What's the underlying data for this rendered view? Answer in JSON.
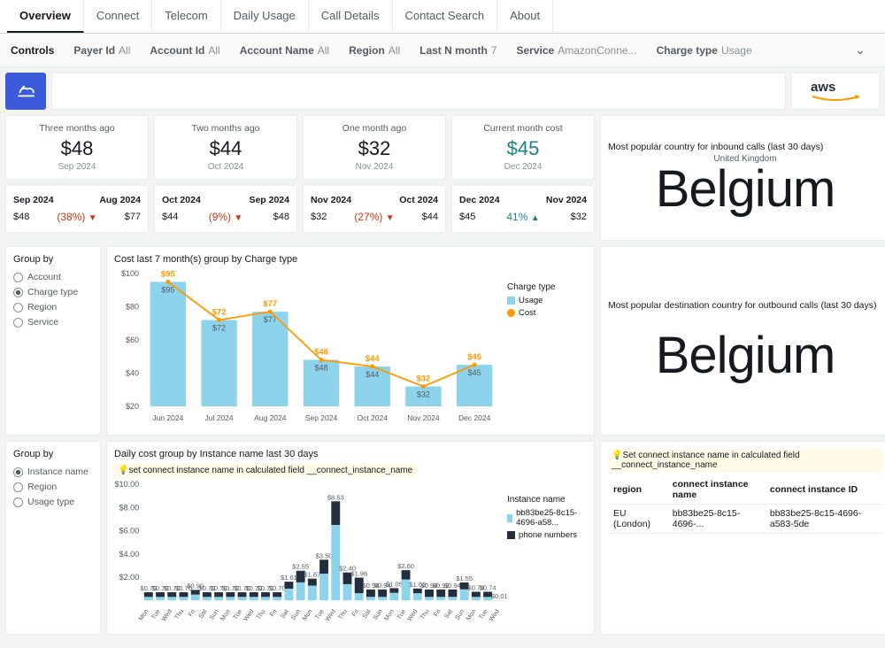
{
  "tabs": [
    "Overview",
    "Connect",
    "Telecom",
    "Daily Usage",
    "Call Details",
    "Contact Search",
    "About"
  ],
  "active_tab": 0,
  "controls": {
    "label": "Controls",
    "items": [
      {
        "label": "Payer Id",
        "value": "All"
      },
      {
        "label": "Account Id",
        "value": "All"
      },
      {
        "label": "Account Name",
        "value": "All"
      },
      {
        "label": "Region",
        "value": "All"
      },
      {
        "label": "Last N month",
        "value": "7"
      },
      {
        "label": "Service",
        "value": "AmazonConne..."
      },
      {
        "label": "Charge type",
        "value": "Usage"
      }
    ]
  },
  "kpis": [
    {
      "title": "Three months ago",
      "value": "$48",
      "sub": "Sep 2024"
    },
    {
      "title": "Two months ago",
      "value": "$44",
      "sub": "Oct 2024"
    },
    {
      "title": "One month ago",
      "value": "$32",
      "sub": "Nov 2024"
    },
    {
      "title": "Current month cost",
      "value": "$45",
      "sub": "Dec 2024",
      "teal": true
    }
  ],
  "comps": [
    {
      "left_m": "Sep 2024",
      "right_m": "Aug 2024",
      "left_v": "$48",
      "right_v": "$77",
      "pct": "(38%)",
      "dir": "down"
    },
    {
      "left_m": "Oct 2024",
      "right_m": "Sep 2024",
      "left_v": "$44",
      "right_v": "$48",
      "pct": "(9%)",
      "dir": "down"
    },
    {
      "left_m": "Nov 2024",
      "right_m": "Oct 2024",
      "left_v": "$32",
      "right_v": "$44",
      "pct": "(27%)",
      "dir": "down"
    },
    {
      "left_m": "Dec 2024",
      "right_m": "Nov 2024",
      "left_v": "$45",
      "right_v": "$32",
      "pct": "41%",
      "dir": "up"
    }
  ],
  "inbound": {
    "label": "Most popular country for inbound calls (last 30 days)",
    "sub": "United Kingdom",
    "value": "Belgium"
  },
  "outbound": {
    "label": "Most popular destination country for outbound calls (last 30 days)",
    "value": "Belgium"
  },
  "groupby1": {
    "title": "Group by",
    "options": [
      "Account",
      "Charge type",
      "Region",
      "Service"
    ],
    "selected": 1
  },
  "groupby2": {
    "title": "Group by",
    "options": [
      "Instance name",
      "Region",
      "Usage type"
    ],
    "selected": 0
  },
  "chart1": {
    "title": "Cost last  7 month(s) group by  Charge type",
    "legend_title": "Charge type",
    "legend": [
      "Usage",
      "Cost"
    ]
  },
  "chart2": {
    "title": "Daily cost group by Instance name last 30 days",
    "hint": "💡set connect instance name in calculated field __connect_instance_name",
    "legend_title": "Instance name",
    "legend": [
      "bb83be25-8c15-4696-a58...",
      "phone numbers"
    ]
  },
  "bottom_right": {
    "hint": "💡Set connect instance name in calculated field __connect_instance_name",
    "headers": [
      "region",
      "connect instance name",
      "connect instance ID"
    ],
    "rows": [
      [
        "EU (London)",
        "bb83be25-8c15-4696-...",
        "bb83be25-8c15-4696-a583-5de"
      ]
    ]
  },
  "chart_data": [
    {
      "type": "bar",
      "title": "Cost last 7 month(s) group by Charge type",
      "categories": [
        "Jun 2024",
        "Jul 2024",
        "Aug 2024",
        "Sep 2024",
        "Oct 2024",
        "Nov 2024",
        "Dec 2024"
      ],
      "series": [
        {
          "name": "Usage",
          "values": [
            95,
            72,
            77,
            48,
            44,
            32,
            45
          ],
          "type": "bar"
        },
        {
          "name": "Cost",
          "values": [
            95,
            72,
            77,
            48,
            44,
            32,
            45
          ],
          "type": "line"
        }
      ],
      "yticks": [
        20,
        40,
        60,
        80,
        100
      ],
      "ylim": [
        20,
        100
      ],
      "ylabel": "",
      "xlabel": ""
    },
    {
      "type": "bar",
      "title": "Daily cost group by Instance name last 30 days",
      "categories": [
        "Mon",
        "Tue",
        "Wed",
        "Thu",
        "Fri",
        "Sat",
        "Sun",
        "Mon",
        "Tue",
        "Wed",
        "Thu",
        "Fri",
        "Sat",
        "Sun",
        "Mon",
        "Tue",
        "Wed",
        "Thu",
        "Fri",
        "Sat",
        "Sun",
        "Mon",
        "Tue",
        "Wed",
        "Thu",
        "Fri",
        "Sat",
        "Sun",
        "Mon",
        "Tue",
        "Wed"
      ],
      "series": [
        {
          "name": "bb83be25-8c15-4696-a58...",
          "values": [
            0.3,
            0.3,
            0.3,
            0.3,
            0.5,
            0.3,
            0.3,
            0.3,
            0.3,
            0.3,
            0.3,
            0.3,
            1.01,
            1.55,
            1.27,
            2.3,
            6.5,
            1.4,
            0.62,
            0.3,
            0.3,
            0.65,
            1.8,
            0.62,
            0.3,
            0.3,
            0.3,
            0.95,
            0.3,
            0.3,
            0.01
          ]
        },
        {
          "name": "phone numbers",
          "values": [
            0.4,
            0.4,
            0.4,
            0.4,
            0.4,
            0.4,
            0.4,
            0.4,
            0.4,
            0.4,
            0.4,
            0.4,
            0.6,
            1.0,
            0.6,
            1.2,
            2.03,
            1.0,
            1.34,
            0.64,
            0.64,
            0.4,
            0.8,
            0.4,
            0.64,
            0.64,
            0.64,
            0.6,
            0.44,
            0.44,
            0.0
          ]
        }
      ],
      "totals": [
        0.7,
        0.7,
        0.7,
        0.7,
        0.9,
        0.7,
        0.7,
        0.7,
        0.7,
        0.7,
        0.7,
        0.7,
        1.61,
        2.55,
        1.87,
        3.5,
        8.53,
        2.4,
        1.96,
        0.94,
        0.94,
        1.05,
        2.6,
        1.02,
        0.94,
        0.92,
        0.94,
        1.55,
        0.74,
        0.74,
        0.01
      ],
      "yticks": [
        2,
        4,
        6,
        8,
        10
      ],
      "ylim": [
        0,
        10
      ],
      "yprefix": "$"
    }
  ]
}
